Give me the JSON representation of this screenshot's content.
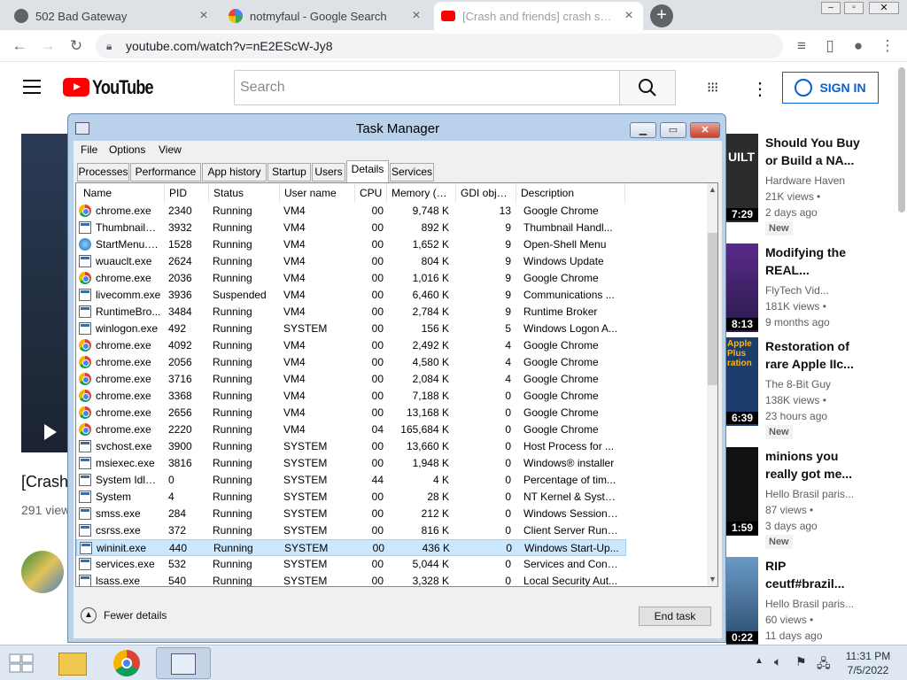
{
  "browser": {
    "tabs": [
      {
        "title": "502 Bad Gateway"
      },
      {
        "title": "notmyfaul - Google Search"
      },
      {
        "title": "[Crash and friends] crash scream..."
      }
    ],
    "url": "youtube.com/watch?v=nE2EScW-Jy8"
  },
  "youtube": {
    "logo_text": "YouTube",
    "search_placeholder": "Search",
    "signin_label": "SIGN IN",
    "video_title_fragment": "[Crash",
    "views_fragment": "291 view",
    "recommendations": [
      {
        "title": "Should You Buy or Build a NA...",
        "channel": "Hardware Haven",
        "views": "21K views •",
        "age": "2 days ago",
        "badge": "New",
        "duration": "7:29",
        "thumb_text": "UILT"
      },
      {
        "title": "Modifying the REAL...",
        "channel": "FlyTech Vid...",
        "views": "181K views •",
        "age": "9 months ago",
        "badge": "",
        "duration": "8:13",
        "thumb_text": ""
      },
      {
        "title": "Restoration of rare Apple IIc...",
        "channel": "The 8-Bit Guy",
        "views": "138K views •",
        "age": "23 hours ago",
        "badge": "New",
        "duration": "6:39",
        "thumb_text": "Apple Plus ration"
      },
      {
        "title": "minions you really got me...",
        "channel": "Hello Brasil paris...",
        "views": "87 views •",
        "age": "3 days ago",
        "badge": "New",
        "duration": "1:59",
        "thumb_text": ""
      },
      {
        "title": "RIP ceutf#brazil...",
        "channel": "Hello Brasil paris...",
        "views": "60 views •",
        "age": "11 days ago",
        "badge": "",
        "duration": "0:22",
        "thumb_text": ""
      }
    ]
  },
  "task_manager": {
    "title": "Task Manager",
    "menu": [
      "File",
      "Options",
      "View"
    ],
    "tabs": [
      "Processes",
      "Performance",
      "App history",
      "Startup",
      "Users",
      "Details",
      "Services"
    ],
    "selected_tab": "Details",
    "columns": [
      "Name",
      "PID",
      "Status",
      "User name",
      "CPU",
      "Memory (p...",
      "GDI obje...",
      "Description"
    ],
    "rows": [
      {
        "icon": "chrome",
        "name": "chrome.exe",
        "pid": "2340",
        "status": "Running",
        "user": "VM4",
        "cpu": "00",
        "mem": "9,748 K",
        "gdi": "13",
        "desc": "Google Chrome"
      },
      {
        "icon": "exe",
        "name": "ThumbnailE...",
        "pid": "3932",
        "status": "Running",
        "user": "VM4",
        "cpu": "00",
        "mem": "892 K",
        "gdi": "9",
        "desc": "Thumbnail Handl..."
      },
      {
        "icon": "shell",
        "name": "StartMenu.e...",
        "pid": "1528",
        "status": "Running",
        "user": "VM4",
        "cpu": "00",
        "mem": "1,652 K",
        "gdi": "9",
        "desc": "Open-Shell Menu"
      },
      {
        "icon": "exe",
        "name": "wuauclt.exe",
        "pid": "2624",
        "status": "Running",
        "user": "VM4",
        "cpu": "00",
        "mem": "804 K",
        "gdi": "9",
        "desc": "Windows Update"
      },
      {
        "icon": "chrome",
        "name": "chrome.exe",
        "pid": "2036",
        "status": "Running",
        "user": "VM4",
        "cpu": "00",
        "mem": "1,016 K",
        "gdi": "9",
        "desc": "Google Chrome"
      },
      {
        "icon": "exe",
        "name": "livecomm.exe",
        "pid": "3936",
        "status": "Suspended",
        "user": "VM4",
        "cpu": "00",
        "mem": "6,460 K",
        "gdi": "9",
        "desc": "Communications ..."
      },
      {
        "icon": "exe",
        "name": "RuntimeBro...",
        "pid": "3484",
        "status": "Running",
        "user": "VM4",
        "cpu": "00",
        "mem": "2,784 K",
        "gdi": "9",
        "desc": "Runtime Broker"
      },
      {
        "icon": "exe",
        "name": "winlogon.exe",
        "pid": "492",
        "status": "Running",
        "user": "SYSTEM",
        "cpu": "00",
        "mem": "156 K",
        "gdi": "5",
        "desc": "Windows Logon A..."
      },
      {
        "icon": "chrome",
        "name": "chrome.exe",
        "pid": "4092",
        "status": "Running",
        "user": "VM4",
        "cpu": "00",
        "mem": "2,492 K",
        "gdi": "4",
        "desc": "Google Chrome"
      },
      {
        "icon": "chrome",
        "name": "chrome.exe",
        "pid": "2056",
        "status": "Running",
        "user": "VM4",
        "cpu": "00",
        "mem": "4,580 K",
        "gdi": "4",
        "desc": "Google Chrome"
      },
      {
        "icon": "chrome",
        "name": "chrome.exe",
        "pid": "3716",
        "status": "Running",
        "user": "VM4",
        "cpu": "00",
        "mem": "2,084 K",
        "gdi": "4",
        "desc": "Google Chrome"
      },
      {
        "icon": "chrome",
        "name": "chrome.exe",
        "pid": "3368",
        "status": "Running",
        "user": "VM4",
        "cpu": "00",
        "mem": "7,188 K",
        "gdi": "0",
        "desc": "Google Chrome"
      },
      {
        "icon": "chrome",
        "name": "chrome.exe",
        "pid": "2656",
        "status": "Running",
        "user": "VM4",
        "cpu": "00",
        "mem": "13,168 K",
        "gdi": "0",
        "desc": "Google Chrome"
      },
      {
        "icon": "chrome",
        "name": "chrome.exe",
        "pid": "2220",
        "status": "Running",
        "user": "VM4",
        "cpu": "04",
        "mem": "165,684 K",
        "gdi": "0",
        "desc": "Google Chrome"
      },
      {
        "icon": "exe",
        "name": "svchost.exe",
        "pid": "3900",
        "status": "Running",
        "user": "SYSTEM",
        "cpu": "00",
        "mem": "13,660 K",
        "gdi": "0",
        "desc": "Host Process for ..."
      },
      {
        "icon": "exe",
        "name": "msiexec.exe",
        "pid": "3816",
        "status": "Running",
        "user": "SYSTEM",
        "cpu": "00",
        "mem": "1,948 K",
        "gdi": "0",
        "desc": "Windows® installer"
      },
      {
        "icon": "exe",
        "name": "System Idle ...",
        "pid": "0",
        "status": "Running",
        "user": "SYSTEM",
        "cpu": "44",
        "mem": "4 K",
        "gdi": "0",
        "desc": "Percentage of tim..."
      },
      {
        "icon": "exe",
        "name": "System",
        "pid": "4",
        "status": "Running",
        "user": "SYSTEM",
        "cpu": "00",
        "mem": "28 K",
        "gdi": "0",
        "desc": "NT Kernel & System"
      },
      {
        "icon": "exe",
        "name": "smss.exe",
        "pid": "284",
        "status": "Running",
        "user": "SYSTEM",
        "cpu": "00",
        "mem": "212 K",
        "gdi": "0",
        "desc": "Windows Session ..."
      },
      {
        "icon": "exe",
        "name": "csrss.exe",
        "pid": "372",
        "status": "Running",
        "user": "SYSTEM",
        "cpu": "00",
        "mem": "816 K",
        "gdi": "0",
        "desc": "Client Server Runti..."
      },
      {
        "icon": "exe",
        "name": "wininit.exe",
        "pid": "440",
        "status": "Running",
        "user": "SYSTEM",
        "cpu": "00",
        "mem": "436 K",
        "gdi": "0",
        "desc": "Windows Start-Up...",
        "selected": true
      },
      {
        "icon": "exe",
        "name": "services.exe",
        "pid": "532",
        "status": "Running",
        "user": "SYSTEM",
        "cpu": "00",
        "mem": "5,044 K",
        "gdi": "0",
        "desc": "Services and Cont..."
      },
      {
        "icon": "exe",
        "name": "lsass.exe",
        "pid": "540",
        "status": "Running",
        "user": "SYSTEM",
        "cpu": "00",
        "mem": "3,328 K",
        "gdi": "0",
        "desc": "Local Security Aut..."
      }
    ],
    "fewer_details_label": "Fewer details",
    "end_task_label": "End task"
  },
  "taskbar": {
    "time": "11:31 PM",
    "date": "7/5/2022"
  }
}
